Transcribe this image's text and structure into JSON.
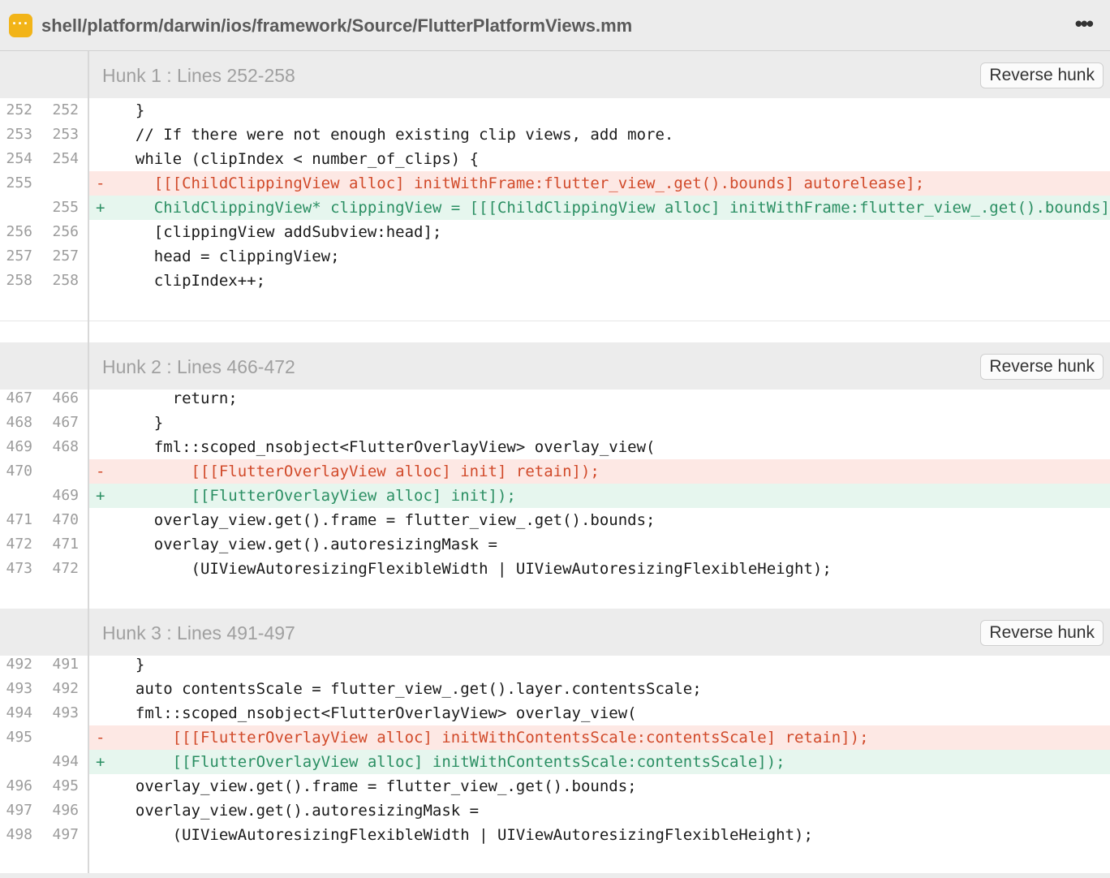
{
  "file": {
    "path": "shell/platform/darwin/ios/framework/Source/FlutterPlatformViews.mm",
    "icon": "more-horizontal-icon",
    "icon_color": "#f2b418"
  },
  "colors": {
    "deleted_bg": "#fde8e4",
    "deleted_text": "#d14a2a",
    "added_bg": "#e6f6ee",
    "added_text": "#2b8f63"
  },
  "hunks": [
    {
      "title": "Hunk 1 : Lines 252-258",
      "button": "Reverse hunk",
      "lines": [
        {
          "old": "252",
          "new": "252",
          "type": "ctx",
          "sign": "",
          "code": "  }"
        },
        {
          "old": "253",
          "new": "253",
          "type": "ctx",
          "sign": "",
          "code": "  // If there were not enough existing clip views, add more."
        },
        {
          "old": "254",
          "new": "254",
          "type": "ctx",
          "sign": "",
          "code": "  while (clipIndex < number_of_clips) {"
        },
        {
          "old": "255",
          "new": "",
          "type": "del",
          "sign": "-",
          "code": "    [[[ChildClippingView alloc] initWithFrame:flutter_view_.get().bounds] autorelease];"
        },
        {
          "old": "",
          "new": "255",
          "type": "add",
          "sign": "+",
          "code": "    ChildClippingView* clippingView = [[[ChildClippingView alloc] initWithFrame:flutter_view_.get().bounds] autorelease];"
        },
        {
          "old": "256",
          "new": "256",
          "type": "ctx",
          "sign": "",
          "code": "    [clippingView addSubview:head];"
        },
        {
          "old": "257",
          "new": "257",
          "type": "ctx",
          "sign": "",
          "code": "    head = clippingView;"
        },
        {
          "old": "258",
          "new": "258",
          "type": "ctx",
          "sign": "",
          "code": "    clipIndex++;"
        }
      ]
    },
    {
      "title": "Hunk 2 : Lines 466-472",
      "button": "Reverse hunk",
      "lines": [
        {
          "old": "467",
          "new": "466",
          "type": "ctx",
          "sign": "",
          "code": "      return;"
        },
        {
          "old": "468",
          "new": "467",
          "type": "ctx",
          "sign": "",
          "code": "    }"
        },
        {
          "old": "469",
          "new": "468",
          "type": "ctx",
          "sign": "",
          "code": "    fml::scoped_nsobject<FlutterOverlayView> overlay_view("
        },
        {
          "old": "470",
          "new": "",
          "type": "del",
          "sign": "-",
          "code": "        [[[FlutterOverlayView alloc] init] retain]);"
        },
        {
          "old": "",
          "new": "469",
          "type": "add",
          "sign": "+",
          "code": "        [[FlutterOverlayView alloc] init]);"
        },
        {
          "old": "471",
          "new": "470",
          "type": "ctx",
          "sign": "",
          "code": "    overlay_view.get().frame = flutter_view_.get().bounds;"
        },
        {
          "old": "472",
          "new": "471",
          "type": "ctx",
          "sign": "",
          "code": "    overlay_view.get().autoresizingMask ="
        },
        {
          "old": "473",
          "new": "472",
          "type": "ctx",
          "sign": "",
          "code": "        (UIViewAutoresizingFlexibleWidth | UIViewAutoresizingFlexibleHeight);"
        }
      ]
    },
    {
      "title": "Hunk 3 : Lines 491-497",
      "button": "Reverse hunk",
      "lines": [
        {
          "old": "492",
          "new": "491",
          "type": "ctx",
          "sign": "",
          "code": "  }"
        },
        {
          "old": "493",
          "new": "492",
          "type": "ctx",
          "sign": "",
          "code": "  auto contentsScale = flutter_view_.get().layer.contentsScale;"
        },
        {
          "old": "494",
          "new": "493",
          "type": "ctx",
          "sign": "",
          "code": "  fml::scoped_nsobject<FlutterOverlayView> overlay_view("
        },
        {
          "old": "495",
          "new": "",
          "type": "del",
          "sign": "-",
          "code": "      [[[FlutterOverlayView alloc] initWithContentsScale:contentsScale] retain]);"
        },
        {
          "old": "",
          "new": "494",
          "type": "add",
          "sign": "+",
          "code": "      [[FlutterOverlayView alloc] initWithContentsScale:contentsScale]);"
        },
        {
          "old": "496",
          "new": "495",
          "type": "ctx",
          "sign": "",
          "code": "  overlay_view.get().frame = flutter_view_.get().bounds;"
        },
        {
          "old": "497",
          "new": "496",
          "type": "ctx",
          "sign": "",
          "code": "  overlay_view.get().autoresizingMask ="
        },
        {
          "old": "498",
          "new": "497",
          "type": "ctx",
          "sign": "",
          "code": "      (UIViewAutoresizingFlexibleWidth | UIViewAutoresizingFlexibleHeight);"
        }
      ]
    }
  ]
}
